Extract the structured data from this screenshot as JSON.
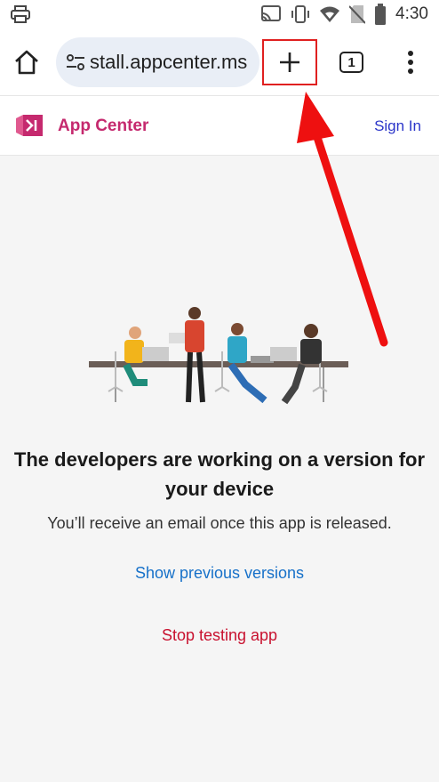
{
  "status_bar": {
    "time": "4:30",
    "icons": [
      "print-icon",
      "cast-icon",
      "vibrate-icon",
      "wifi-icon",
      "no-sim-icon",
      "battery-icon"
    ]
  },
  "browser": {
    "url_text": "stall.appcenter.ms",
    "tab_count": "1",
    "highlight_color": "#e02020"
  },
  "app_header": {
    "title": "App Center",
    "sign_in_label": "Sign In",
    "brand_color": "#c5296e"
  },
  "main": {
    "headline": "The developers are working on a version for your device",
    "subtext": "You’ll receive an email once this app is released.",
    "show_previous_label": "Show previous versions",
    "stop_testing_label": "Stop testing app"
  }
}
